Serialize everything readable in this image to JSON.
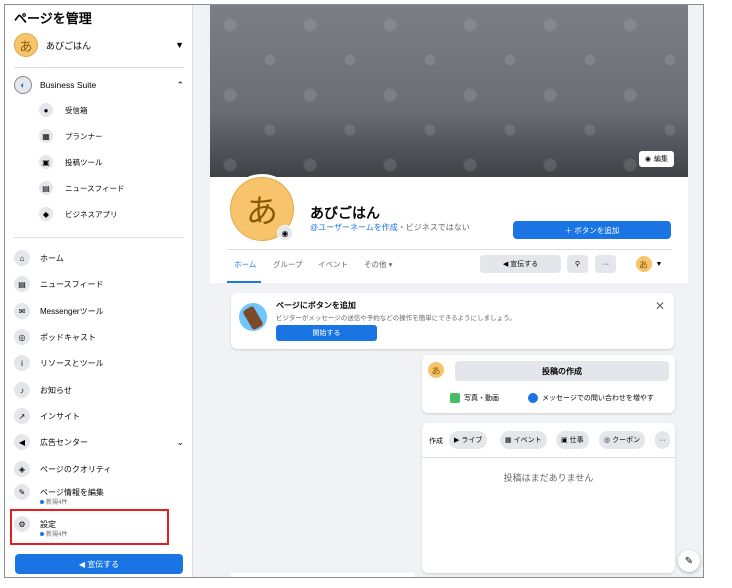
{
  "sidebar": {
    "title": "ページを管理",
    "page_name": "あびごはん",
    "avatar_char": "あ",
    "business_suite": "Business Suite",
    "suite_items": [
      {
        "label": "受信箱",
        "icon": "chat-icon"
      },
      {
        "label": "プランナー",
        "icon": "calendar-icon"
      },
      {
        "label": "投稿ツール",
        "icon": "posts-icon"
      },
      {
        "label": "ニュースフィード",
        "icon": "news-icon"
      },
      {
        "label": "ビジネスアプリ",
        "icon": "apps-icon"
      }
    ],
    "nav_items": [
      {
        "label": "ホーム",
        "icon": "home-icon"
      },
      {
        "label": "ニュースフィード",
        "icon": "newsfeed-icon"
      },
      {
        "label": "Messengerツール",
        "icon": "messenger-icon"
      },
      {
        "label": "ポッドキャスト",
        "icon": "podcast-icon"
      },
      {
        "label": "リソースとツール",
        "icon": "info-icon"
      },
      {
        "label": "お知らせ",
        "icon": "bell-icon"
      },
      {
        "label": "インサイト",
        "icon": "insights-icon"
      },
      {
        "label": "広告センター",
        "icon": "megaphone-icon"
      },
      {
        "label": "ページのクオリティ",
        "icon": "shield-icon"
      },
      {
        "label": "ページ情報を編集",
        "icon": "pencil-icon",
        "sub": "新規4件"
      },
      {
        "label": "設定",
        "icon": "gear-icon",
        "sub": "新規4件"
      }
    ],
    "promote_label": "宣伝する"
  },
  "main": {
    "cover_edit": "編集",
    "avatar_char": "あ",
    "page_name": "あびごはん",
    "username_link": "@ユーザーネームを作成",
    "category": "・ビジネスではない",
    "add_button": "＋ ボタンを追加",
    "tabs": [
      "ホーム",
      "グループ",
      "イベント",
      "その他 ▾"
    ],
    "promote_label": "宣伝する",
    "more_label": "···",
    "promo": {
      "title": "ページにボタンを追加",
      "desc": "ビジターがメッセージの送信や予約などの操作を簡単にできるようにしましょう。",
      "button": "開始する"
    },
    "create_post": {
      "compose": "投稿の作成",
      "photo_video": "写真・動画",
      "messages": "メッセージでの問い合わせを増やす"
    },
    "create_bar": {
      "label": "作成",
      "chips": [
        "ライブ",
        "イベント",
        "仕事",
        "クーポン",
        "···"
      ],
      "empty": "投稿はまだありません"
    }
  },
  "colors": {
    "accent": "#1b74e4",
    "highlight": "#e41e1e",
    "avatar": "#f7c46c"
  }
}
